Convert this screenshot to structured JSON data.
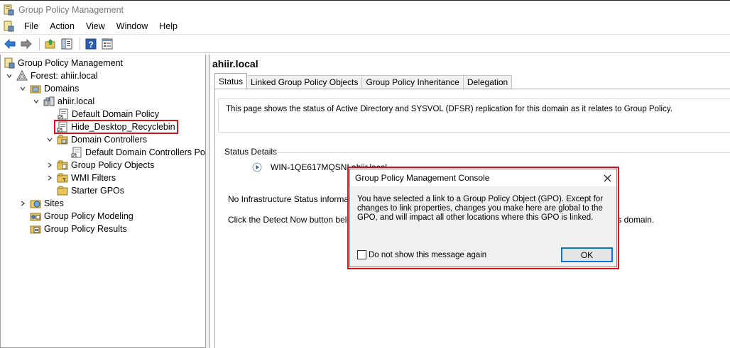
{
  "window": {
    "title": "Group Policy Management"
  },
  "menu": {
    "items": [
      "File",
      "Action",
      "View",
      "Window",
      "Help"
    ]
  },
  "toolbar": {
    "icons": [
      "back-arrow-icon",
      "forward-arrow-icon",
      "up-folder-icon",
      "show-hide-tree-icon",
      "help-icon",
      "properties-icon"
    ]
  },
  "tree": {
    "items": [
      {
        "label": "Group Policy Management",
        "icon": "gpm-console-icon"
      },
      {
        "label": "Forest: ahiir.local",
        "icon": "forest-icon"
      },
      {
        "label": "Domains",
        "icon": "domains-folder-icon"
      },
      {
        "label": "ahiir.local",
        "icon": "domain-icon"
      },
      {
        "label": "Default Domain Policy",
        "icon": "gpo-link-icon"
      },
      {
        "label": "Hide_Desktop_Recyclebin",
        "icon": "gpo-link-icon"
      },
      {
        "label": "Domain Controllers",
        "icon": "ou-folder-icon"
      },
      {
        "label": "Default Domain Controllers Poli",
        "icon": "gpo-link-icon"
      },
      {
        "label": "Group Policy Objects",
        "icon": "folder-icon"
      },
      {
        "label": "WMI Filters",
        "icon": "folder-icon"
      },
      {
        "label": "Starter GPOs",
        "icon": "folder-icon"
      },
      {
        "label": "Sites",
        "icon": "sites-icon"
      },
      {
        "label": "Group Policy Modeling",
        "icon": "modeling-icon"
      },
      {
        "label": "Group Policy Results",
        "icon": "results-icon"
      }
    ]
  },
  "main": {
    "domain_title": "ahiir.local",
    "tabs": [
      "Status",
      "Linked Group Policy Objects",
      "Group Policy Inheritance",
      "Delegation"
    ],
    "info_text": "This page shows the status of Active Directory and SYSVOL (DFSR) replication for this domain as it relates to Group Policy.",
    "status_details_label": "Status Details",
    "server_name": "WIN-1QE617MQSNI.ahiir.local",
    "para1": "No Infrastructure Status information exists for this domain.",
    "para2": "Click the Detect Now button below to gather infrastructure status from all of the domain controllers in this domain."
  },
  "dialog": {
    "title": "Group Policy Management Console",
    "message": "You have selected a link to a Group Policy Object (GPO). Except for changes to link properties, changes you make here are global to the GPO, and will impact all other locations where this GPO is linked.",
    "checkbox_label": "Do not show this message again",
    "ok_label": "OK"
  },
  "colors": {
    "highlight": "#d6141c",
    "focus": "#0078d7"
  }
}
